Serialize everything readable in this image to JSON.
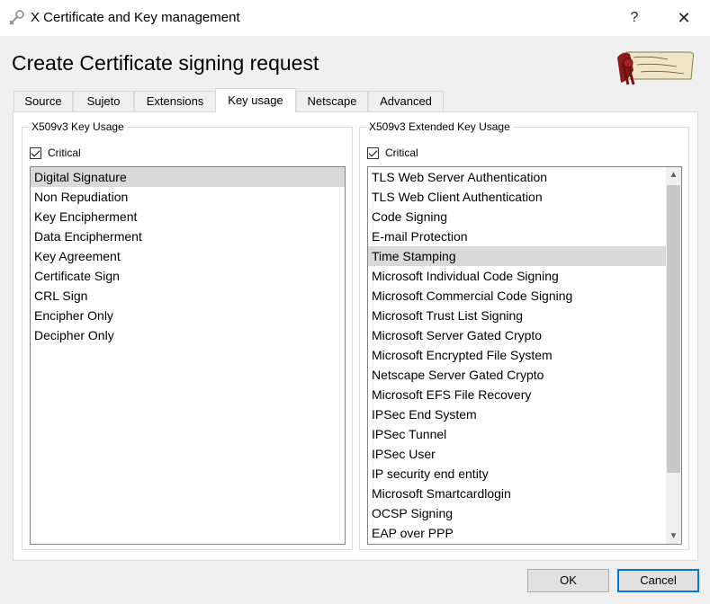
{
  "window": {
    "title": "X Certificate and Key management",
    "help_label": "?",
    "close_label": "✕",
    "icon": "certificate-key-icon"
  },
  "heading": "Create Certificate signing request",
  "logo": {
    "icon": "scroll-logo-icon"
  },
  "tabs": [
    {
      "label": "Source"
    },
    {
      "label": "Sujeto"
    },
    {
      "label": "Extensions"
    },
    {
      "label": "Key usage"
    },
    {
      "label": "Netscape"
    },
    {
      "label": "Advanced"
    }
  ],
  "active_tab": "Key usage",
  "key_usage": {
    "title": "X509v3 Key Usage",
    "critical_label": "Critical",
    "critical_checked": true,
    "selected": "Digital Signature",
    "items": [
      "Digital Signature",
      "Non Repudiation",
      "Key Encipherment",
      "Data Encipherment",
      "Key Agreement",
      "Certificate Sign",
      "CRL Sign",
      "Encipher Only",
      "Decipher Only"
    ]
  },
  "extended_key_usage": {
    "title": "X509v3 Extended Key Usage",
    "critical_label": "Critical",
    "critical_checked": true,
    "selected": "Time Stamping",
    "items": [
      "TLS Web Server Authentication",
      "TLS Web Client Authentication",
      "Code Signing",
      "E-mail Protection",
      "Time Stamping",
      "Microsoft Individual Code Signing",
      "Microsoft Commercial Code Signing",
      "Microsoft Trust List Signing",
      "Microsoft Server Gated Crypto",
      "Microsoft Encrypted File System",
      "Netscape Server Gated Crypto",
      "Microsoft EFS File Recovery",
      "IPSec End System",
      "IPSec Tunnel",
      "IPSec User",
      "IP security end entity",
      "Microsoft Smartcardlogin",
      "OCSP Signing",
      "EAP over PPP"
    ]
  },
  "buttons": {
    "ok": "OK",
    "cancel": "Cancel"
  }
}
